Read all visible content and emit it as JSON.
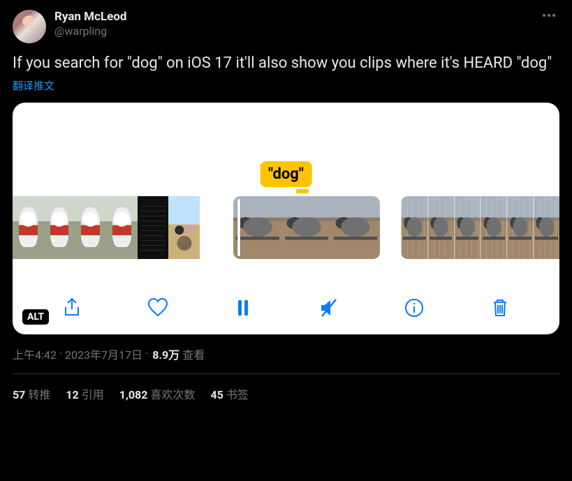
{
  "author": {
    "display_name": "Ryan McLeod",
    "handle": "@warpling"
  },
  "tweet_text": "If you search for \"dog\" on iOS 17 it'll also show you clips where it's HEARD \"dog\"",
  "translate_label": "翻译推文",
  "media": {
    "caption_bubble": "\"dog\"",
    "alt_badge": "ALT"
  },
  "meta": {
    "time": "上午4:42",
    "dot1": " · ",
    "date": "2023年7月17日",
    "dot2": " · ",
    "views_count": "8.9万",
    "views_label": " 查看"
  },
  "stats": {
    "retweets_count": "57",
    "retweets_label": "转推",
    "quotes_count": "12",
    "quotes_label": "引用",
    "likes_count": "1,082",
    "likes_label": "喜欢次数",
    "bookmarks_count": "45",
    "bookmarks_label": "书签"
  }
}
